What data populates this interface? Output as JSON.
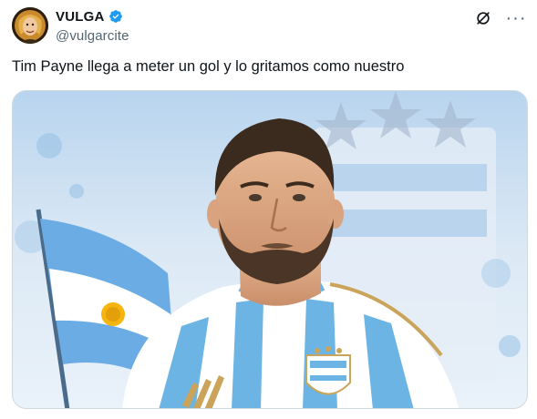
{
  "author": {
    "display_name": "VULGA",
    "handle": "@vulgarcite",
    "verified": true,
    "avatar_icon": "avatar-image"
  },
  "header_actions": {
    "grok_icon": "slash-circle-icon",
    "more_icon": "more-dots-icon",
    "more_label": "···"
  },
  "tweet": {
    "text": "Tim Payne llega a meter un gol y lo gritamos como nuestro"
  },
  "media": {
    "kind": "photo",
    "description_icon": "player-photo"
  },
  "colors": {
    "verified_blue": "#1d9bf0",
    "text_primary": "#0f1419",
    "text_secondary": "#536471",
    "jersey_blue": "#6cb4e4"
  }
}
